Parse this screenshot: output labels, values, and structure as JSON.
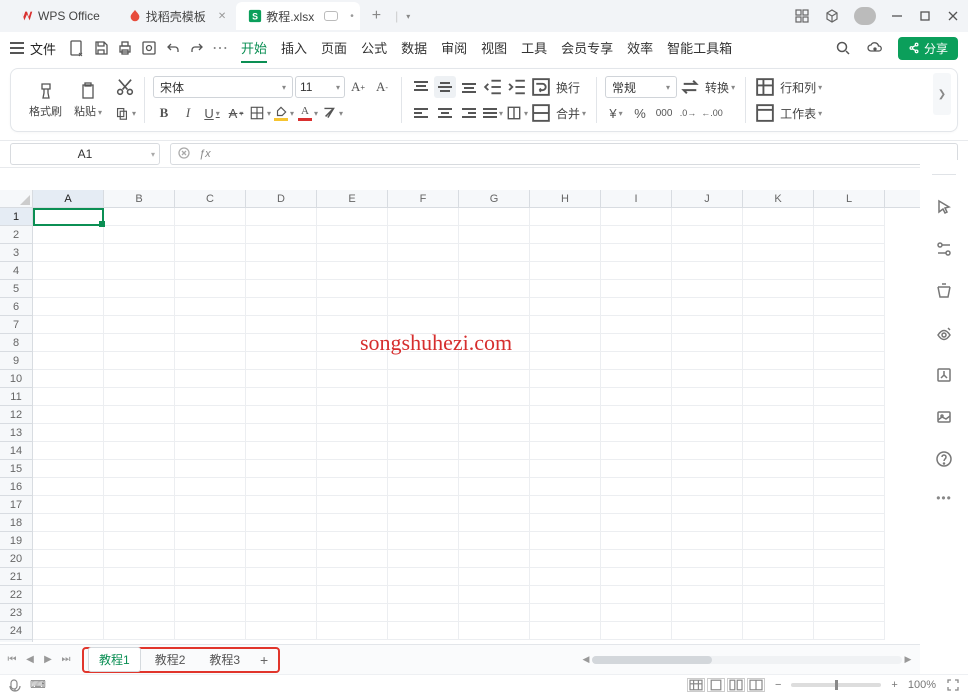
{
  "titlebar": {
    "app_tab": "WPS Office",
    "template_tab": "找稻壳模板",
    "doc_tab": "教程.xlsx"
  },
  "menubar": {
    "file": "文件",
    "tabs": [
      "开始",
      "插入",
      "页面",
      "公式",
      "数据",
      "审阅",
      "视图",
      "工具",
      "会员专享",
      "效率",
      "智能工具箱"
    ],
    "share": "分享"
  },
  "ribbon": {
    "format_painter": "格式刷",
    "paste": "粘贴",
    "font_name": "宋体",
    "font_size": "11",
    "wrap": "换行",
    "merge": "合并",
    "number_format": "常规",
    "convert": "转换",
    "rowcol": "行和列",
    "sheet": "工作表"
  },
  "name_box": "A1",
  "columns": [
    "A",
    "B",
    "C",
    "D",
    "E",
    "F",
    "G",
    "H",
    "I",
    "J",
    "K",
    "L"
  ],
  "rows": [
    "1",
    "2",
    "3",
    "4",
    "5",
    "6",
    "7",
    "8",
    "9",
    "10",
    "11",
    "12",
    "13",
    "14",
    "15",
    "16",
    "17",
    "18",
    "19",
    "20",
    "21",
    "22",
    "23",
    "24"
  ],
  "watermark": "songshuhezi.com",
  "sheets": [
    "教程1",
    "教程2",
    "教程3"
  ],
  "zoom": "100%"
}
